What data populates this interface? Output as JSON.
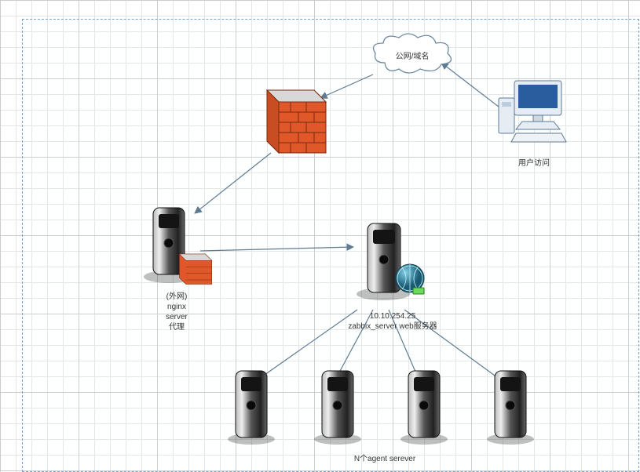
{
  "nodes": {
    "cloud": {
      "label": "公网/域名"
    },
    "client": {
      "label": "用户访问"
    },
    "firewall": {
      "label": ""
    },
    "nginx": {
      "label": "(外网)\nnginx\nserver\n代理"
    },
    "zabbix": {
      "label": "10.10.254.25\nzabbix_server web服务器"
    },
    "agents": {
      "label": "N个agent serever"
    }
  },
  "colors": {
    "brick": "#e0572a",
    "mortar": "#b1421f",
    "steel_dark": "#222",
    "steel_light": "#9a9a9a",
    "globe": "#2e8aa8",
    "arrow": "#5d7b93"
  },
  "chart_data": {
    "type": "diagram",
    "title": "",
    "nodes": [
      {
        "id": "client",
        "label": "用户访问",
        "type": "workstation"
      },
      {
        "id": "cloud",
        "label": "公网/域名",
        "type": "cloud"
      },
      {
        "id": "firewall",
        "label": "",
        "type": "firewall"
      },
      {
        "id": "nginx",
        "label": "(外网) nginx server 代理",
        "type": "server-firewall"
      },
      {
        "id": "zabbix",
        "label": "10.10.254.25 zabbix_server web服务器",
        "type": "web-server",
        "ip": "10.10.254.25"
      },
      {
        "id": "agent1",
        "label": "",
        "type": "server",
        "group": "agents"
      },
      {
        "id": "agent2",
        "label": "",
        "type": "server",
        "group": "agents"
      },
      {
        "id": "agent3",
        "label": "",
        "type": "server",
        "group": "agents"
      },
      {
        "id": "agent4",
        "label": "",
        "type": "server",
        "group": "agents"
      }
    ],
    "node_groups": [
      {
        "id": "agents",
        "label": "N个agent serever"
      }
    ],
    "edges": [
      {
        "from": "client",
        "to": "cloud",
        "directed": true
      },
      {
        "from": "cloud",
        "to": "firewall",
        "directed": true
      },
      {
        "from": "firewall",
        "to": "nginx",
        "directed": true
      },
      {
        "from": "nginx",
        "to": "zabbix",
        "directed": true
      },
      {
        "from": "zabbix",
        "to": "agent1",
        "directed": true
      },
      {
        "from": "zabbix",
        "to": "agent2",
        "directed": true
      },
      {
        "from": "zabbix",
        "to": "agent3",
        "directed": true
      },
      {
        "from": "zabbix",
        "to": "agent4",
        "directed": true
      }
    ]
  }
}
